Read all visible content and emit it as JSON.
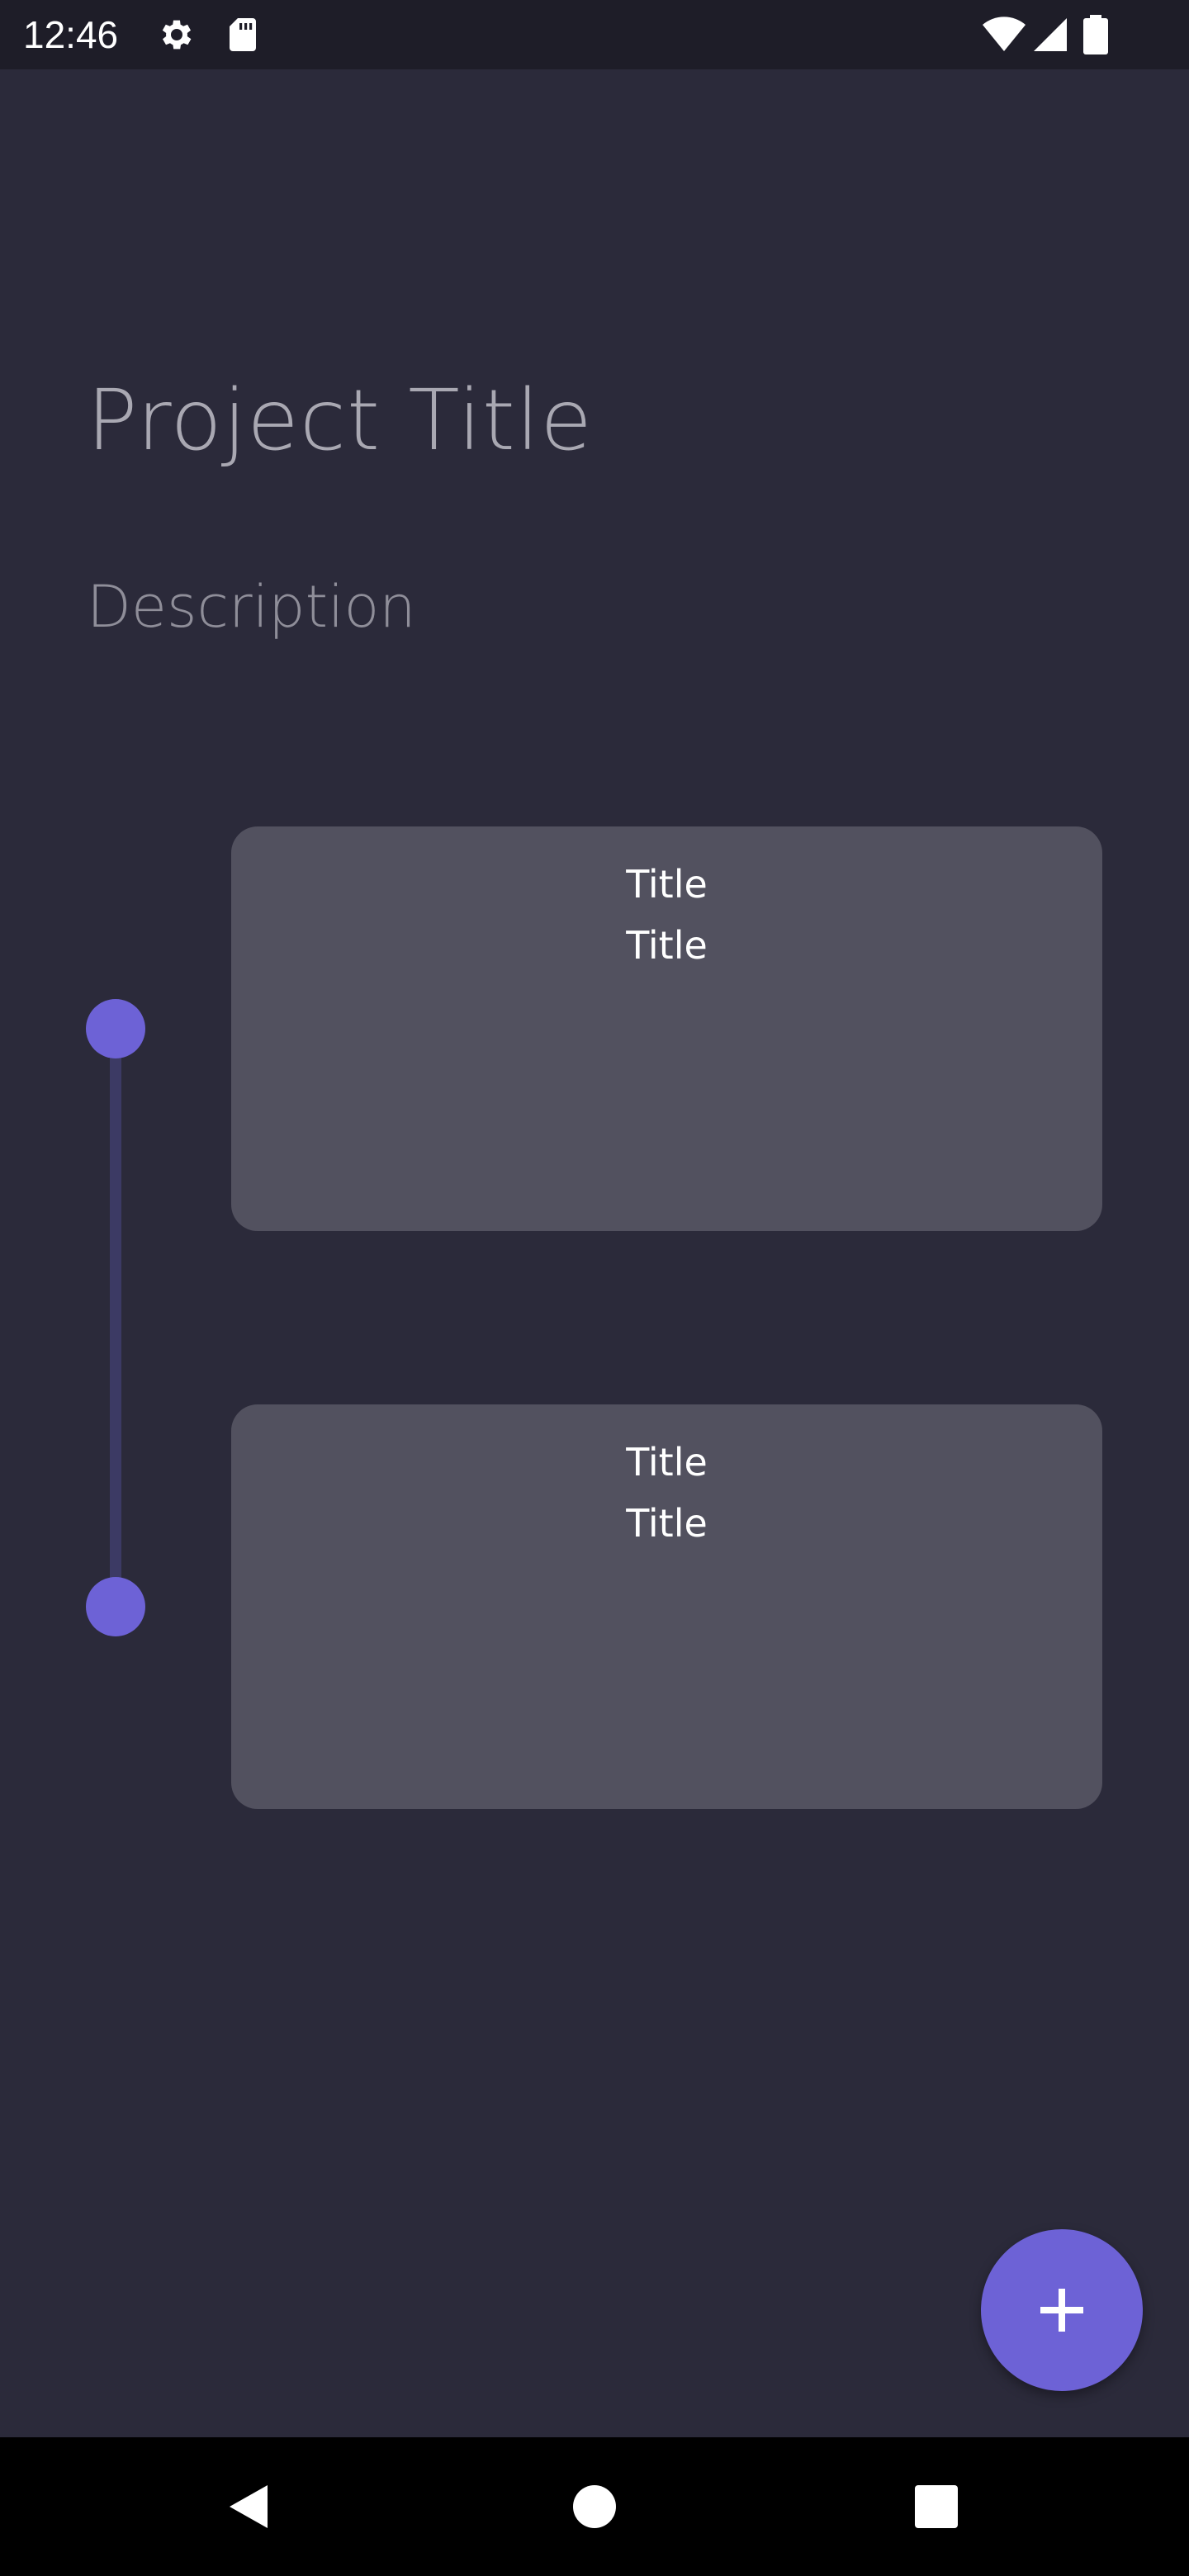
{
  "status_bar": {
    "time": "12:46",
    "icons": [
      "gear-icon",
      "sd-card-icon",
      "wifi-icon",
      "signal-icon",
      "battery-icon"
    ]
  },
  "project": {
    "title": "Project Title",
    "description": "Description"
  },
  "cards": [
    {
      "line1": "Title",
      "line2": "Title"
    },
    {
      "line1": "Title",
      "line2": "Title"
    }
  ],
  "fab": {
    "icon": "plus-icon"
  },
  "nav": {
    "icons": [
      "back-icon",
      "home-icon",
      "recents-icon"
    ]
  },
  "colors": {
    "background": "#2b2a3a",
    "status_bar": "#1e1d28",
    "card": "#52515f",
    "accent": "#6d62d6",
    "timeline": "#3c3a64",
    "title_text": "#a9a8b2"
  }
}
